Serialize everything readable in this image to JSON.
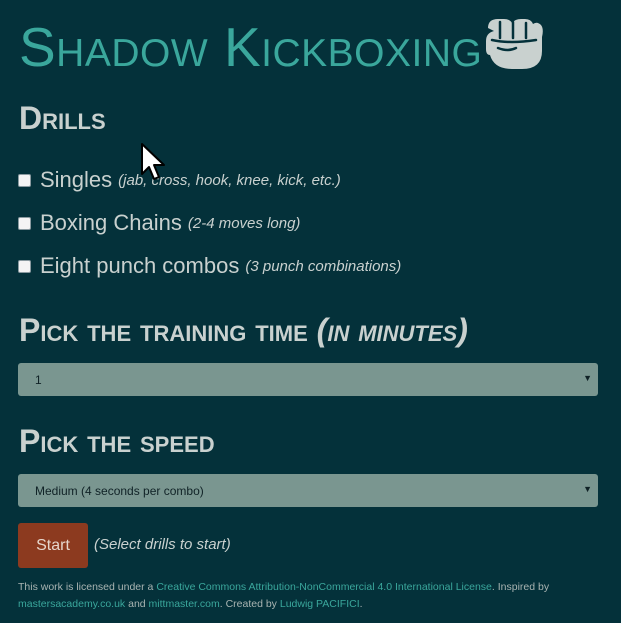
{
  "app": {
    "title": "Shadow Kickboxing",
    "logo_icon": "fist-icon"
  },
  "drills": {
    "heading": "Drills",
    "items": [
      {
        "label": "Singles",
        "note": "(jab, cross, hook, knee, kick, etc.)",
        "checked": false
      },
      {
        "label": "Boxing Chains",
        "note": "(2-4 moves long)",
        "checked": false
      },
      {
        "label": "Eight punch combos",
        "note": "(3 punch combinations)",
        "checked": false
      }
    ]
  },
  "training_time": {
    "heading": "Pick the training time",
    "heading_suffix": "(in minutes)",
    "selected": "1"
  },
  "speed": {
    "heading": "Pick the speed",
    "selected": "Medium (4 seconds per combo)"
  },
  "start": {
    "button_label": "Start",
    "hint": "(Select drills to start)"
  },
  "footer": {
    "text_1": "This work is licensed under a ",
    "license_link": "Creative Commons Attribution-NonCommercial 4.0 International License",
    "text_2": ". Inspired by ",
    "link_1": "mastersacademy.co.uk",
    "text_3": " and ",
    "link_2": "mittmaster.com",
    "text_4": ". Created by ",
    "author_link": "Ludwig PACIFICI",
    "text_5": "."
  },
  "colors": {
    "background": "#04313a",
    "accent": "#3aa79c",
    "start_button": "#8c3a1f",
    "select_bg": "#7a9690"
  }
}
